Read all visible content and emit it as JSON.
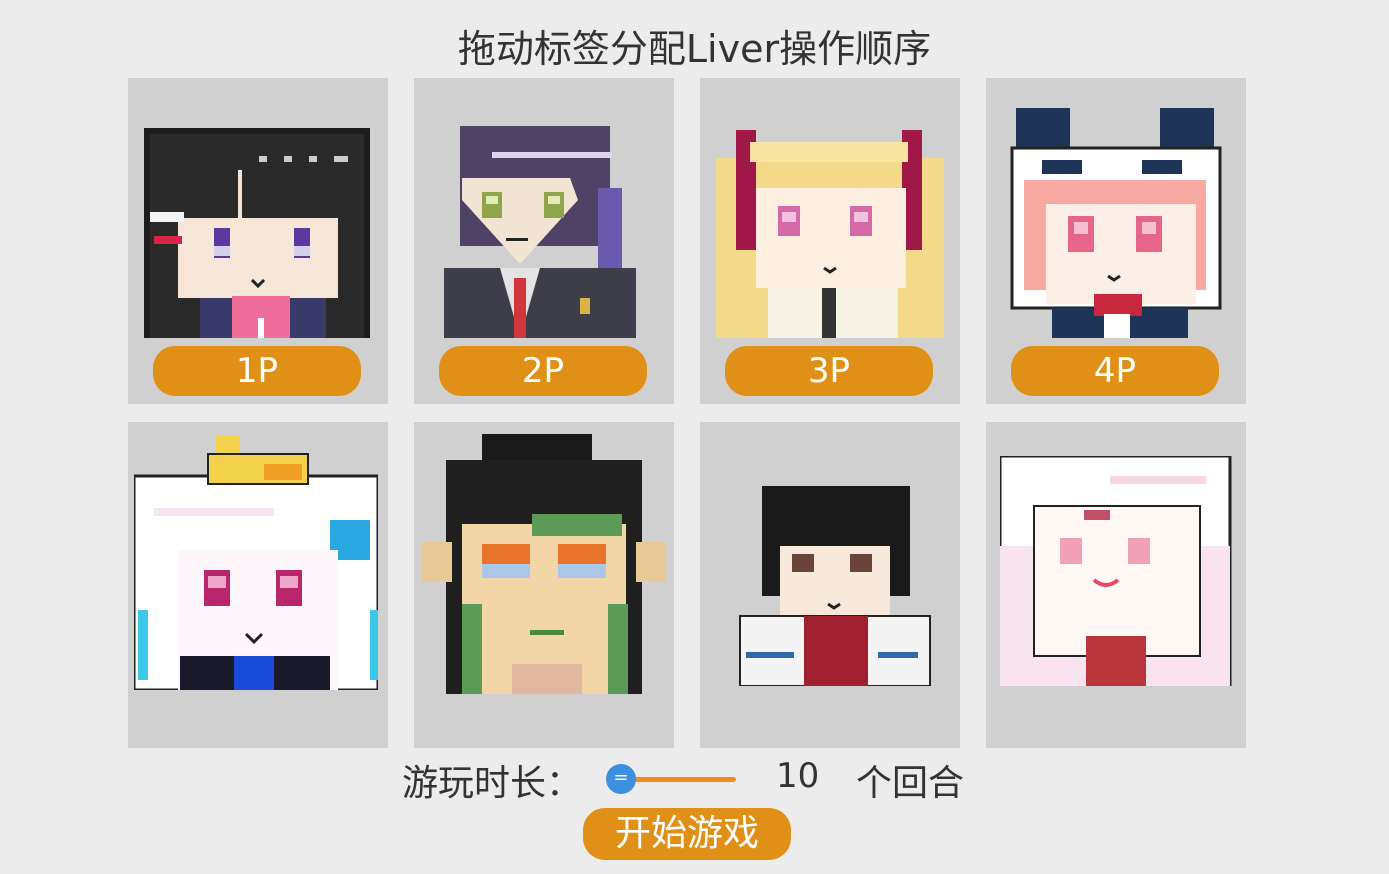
{
  "title": "拖动标签分配Liver操作顺序",
  "cards": [
    {
      "tag": "1P",
      "avatar": "black-hair-girl-avatar"
    },
    {
      "tag": "2P",
      "avatar": "purple-hair-boy-avatar"
    },
    {
      "tag": "3P",
      "avatar": "blonde-twintail-avatar"
    },
    {
      "tag": "4P",
      "avatar": "pink-hair-hood-avatar"
    },
    {
      "tag": "",
      "avatar": "white-hair-duck-avatar"
    },
    {
      "tag": "",
      "avatar": "topknot-man-avatar"
    },
    {
      "tag": "",
      "avatar": "short-black-hair-avatar"
    },
    {
      "tag": "",
      "avatar": "white-bunny-avatar"
    }
  ],
  "duration": {
    "label": "游玩时长：",
    "value": "10",
    "unit": "个回合",
    "slider_level": 0
  },
  "start_button": "开始游戏",
  "colors": {
    "tag_orange": "#e09016",
    "slider_track": "#f08a24",
    "slider_knob": "#3d8fe0",
    "card_bg": "#d0d0d0",
    "page_bg": "#ececec"
  }
}
